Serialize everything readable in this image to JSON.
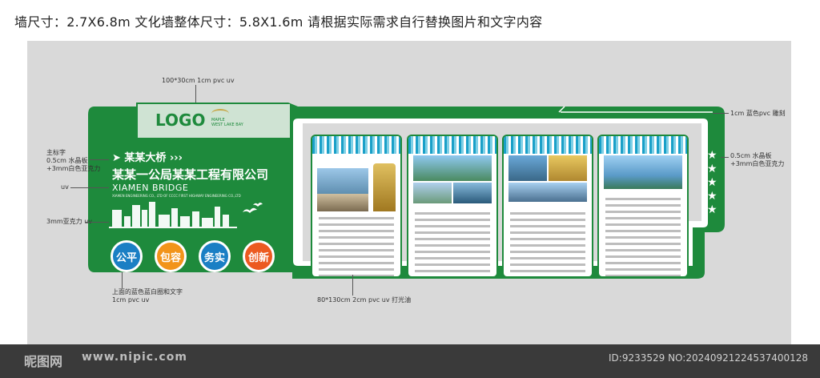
{
  "header": "墙尺寸：2.7X6.8m  文化墙整体尺寸：5.8X1.6m  请根据实际需求自行替换图片和文字内容",
  "annotations": {
    "logo_spec": "100*30cm  1cm pvc uv",
    "title_spec_1": "主标字",
    "title_spec_2": "0.5cm 水晶板",
    "title_spec_3": "+3mm白色亚克力",
    "uv": "uv",
    "acrylic_uv": "3mm亚克力 uv",
    "circle_spec_1": "上面的蓝色蓝白圈和文字",
    "circle_spec_2": "1cm pvc uv",
    "board_spec": "80*130cm 2cm pvc uv 打光油",
    "border_spec": "1cm 蓝色pvc 雕刻",
    "right_spec_1": "0.5cm 水晶板",
    "right_spec_2": "+3mm白色亚克力"
  },
  "logo": {
    "text": "LOGO",
    "sub1": "MAPLE",
    "sub2": "WEST LAKE BAY"
  },
  "title": {
    "bridge": "➤ 某某大桥 ›››",
    "company": "某某一公局某某工程有限公司",
    "english": "XIAMEN BRIDGE",
    "english_small": "XIAMEN ENGINEERING CO., LTD OF CCCC FIRST HIGHWAY ENGINEERING CO.,LTD"
  },
  "slogans": [
    {
      "text": "公平",
      "color": "#1a7fc4"
    },
    {
      "text": "包容",
      "color": "#f2941a"
    },
    {
      "text": "务实",
      "color": "#1a7fc4"
    },
    {
      "text": "创新",
      "color": "#ec5a20"
    }
  ],
  "watermark": {
    "site": "昵图网",
    "url": "www.nipic.com",
    "id": "ID:9233529 NO:20240921224537400128"
  },
  "colors": {
    "green": "#1e8a3c",
    "dark_green": "#176b2f",
    "blue": "#1a7fc4"
  }
}
